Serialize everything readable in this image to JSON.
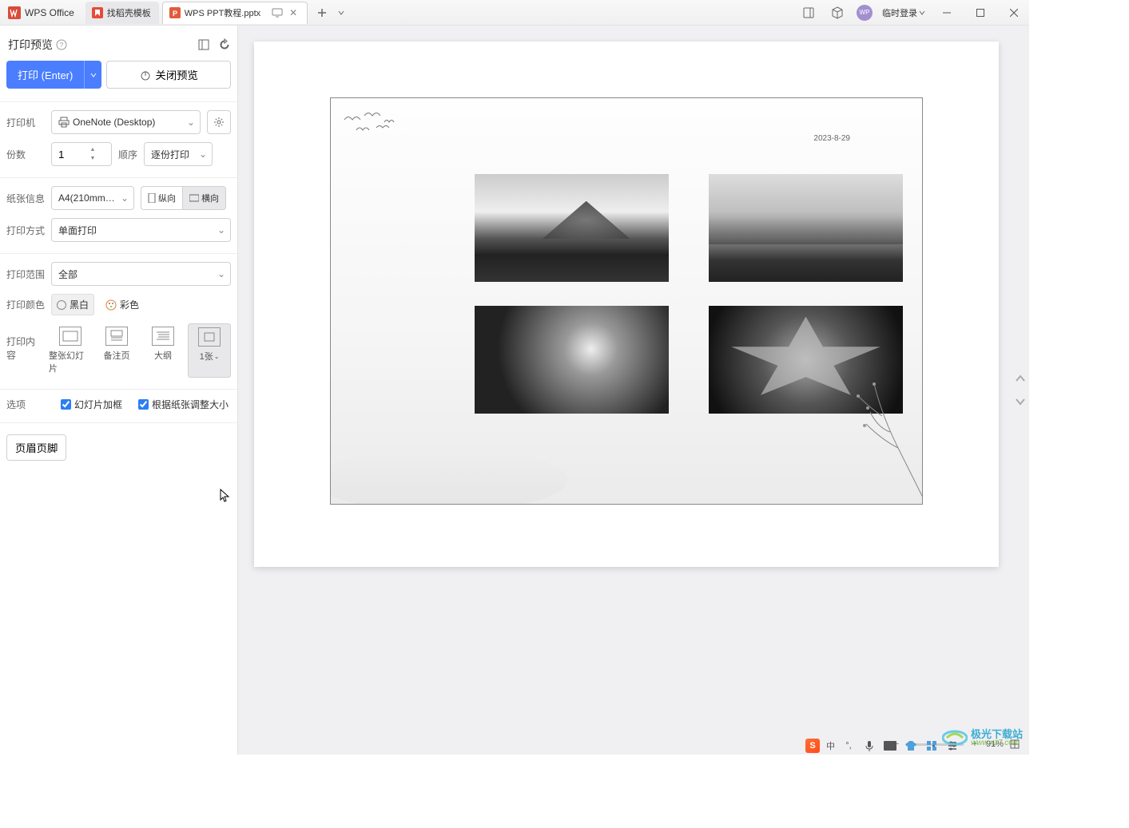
{
  "title_bar": {
    "app_name": "WPS Office",
    "tabs": [
      {
        "label": "找稻壳模板",
        "icon": "docer"
      },
      {
        "label": "WPS PPT教程.pptx",
        "icon": "ppt",
        "active": true
      }
    ],
    "login_text": "临时登录"
  },
  "sidebar": {
    "title": "打印预览",
    "print_button": "打印 (Enter)",
    "close_preview": "关闭预览",
    "printer_label": "打印机",
    "printer_value": "OneNote (Desktop)",
    "copies_label": "份数",
    "copies_value": "1",
    "collate_label": "顺序",
    "collate_value": "逐份打印",
    "paper_label": "纸张信息",
    "paper_value": "A4(210mmx...",
    "orientation_portrait": "纵向",
    "orientation_landscape": "横向",
    "duplex_label": "打印方式",
    "duplex_value": "单面打印",
    "range_label": "打印范围",
    "range_value": "全部",
    "color_label": "打印颜色",
    "color_bw": "黑白",
    "color_color": "彩色",
    "content_label": "打印内容",
    "content_opts": [
      "整张幻灯片",
      "备注页",
      "大纲",
      "1张"
    ],
    "options_label": "选项",
    "opt_frame": "幻灯片加框",
    "opt_scale": "根据纸张调整大小",
    "header_footer": "页眉页脚"
  },
  "preview": {
    "date": "2023-8-29"
  },
  "status": {
    "zoom": "91%",
    "ime": "中"
  },
  "watermark": {
    "brand": "极光下载站",
    "url": "www.xz7.com"
  }
}
